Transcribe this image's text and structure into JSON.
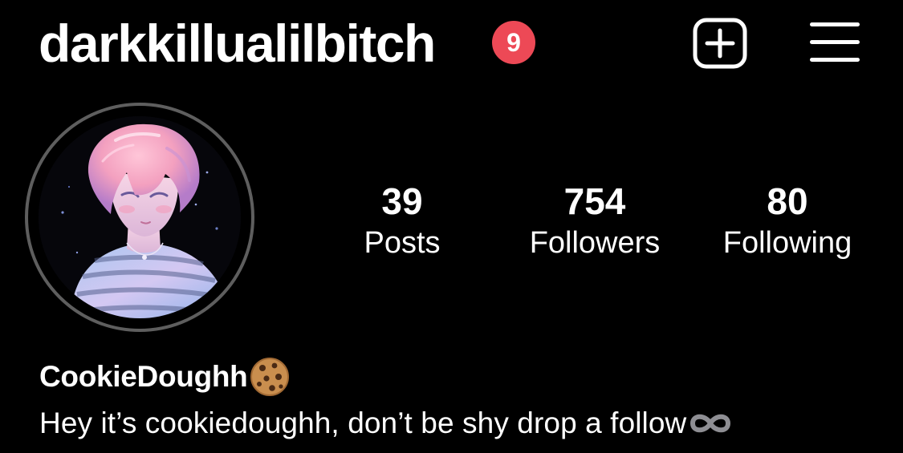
{
  "header": {
    "username": "darkkillualilbitch",
    "notification_count": "9"
  },
  "colors": {
    "background": "#000000",
    "text": "#ffffff",
    "badge": "#ed4956",
    "avatar_ring": "#5e5e5e"
  },
  "icons": {
    "new_post": "plus-square-icon",
    "menu": "hamburger-menu-icon",
    "display_name_emoji": "cookie-icon",
    "bio_emoji": "infinity-icon"
  },
  "stats": [
    {
      "value": "39",
      "label": "Posts"
    },
    {
      "value": "754",
      "label": "Followers"
    },
    {
      "value": "80",
      "label": "Following"
    }
  ],
  "profile": {
    "display_name": "CookieDoughh",
    "bio": "Hey it’s cookiedoughh, don’t be shy drop a follow"
  }
}
